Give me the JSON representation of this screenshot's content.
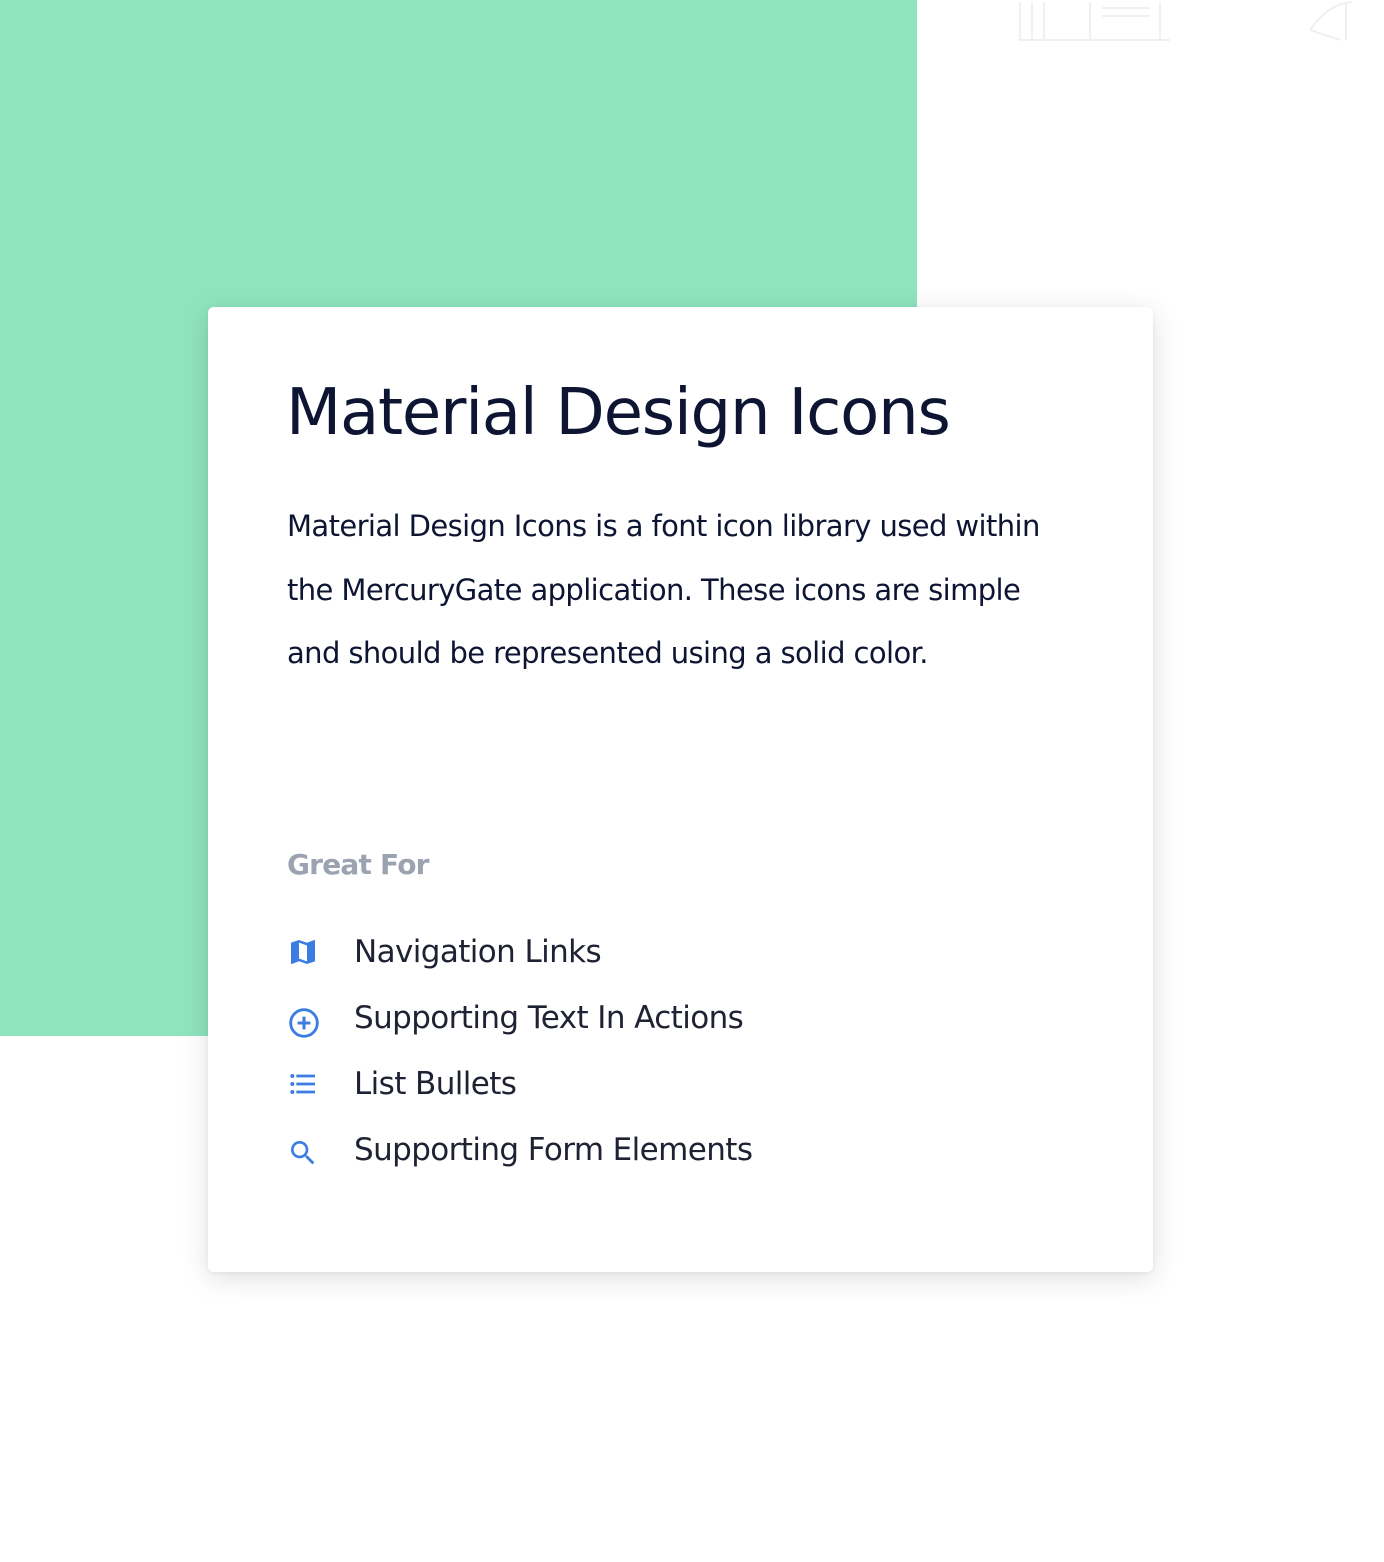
{
  "colors": {
    "accent_green": "#8fe4be",
    "icon_blue": "#3b7de0",
    "title_text": "#0d1533",
    "muted_label": "#9ca3b0"
  },
  "card": {
    "title": "Material Design Icons",
    "description": "Material Design Icons is a font icon library used within\nthe MercuryGate application.  These icons are simple\nand should be represented using a solid color.",
    "section_label": "Great For",
    "items": [
      {
        "icon": "map-icon",
        "label": "Navigation Links"
      },
      {
        "icon": "plus-circle-icon",
        "label": "Supporting Text In Actions"
      },
      {
        "icon": "list-bulleted-icon",
        "label": "List Bullets"
      },
      {
        "icon": "magnify-icon",
        "label": "Supporting Form Elements"
      }
    ]
  }
}
